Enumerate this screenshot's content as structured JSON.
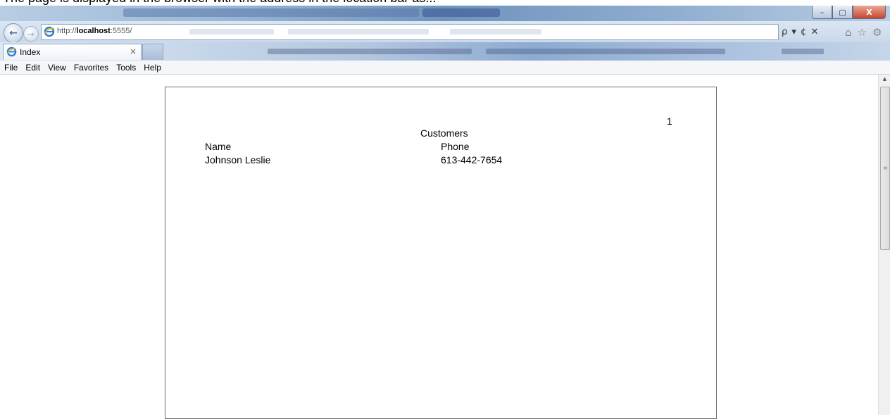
{
  "caption": {
    "text": "The page is displayed in the browser with the address in the location bar as..."
  },
  "window": {
    "controls": {
      "minimize": "–",
      "maximize": "▢",
      "close": "X"
    }
  },
  "nav": {
    "back_icon": "back-arrow-icon",
    "forward_icon": "forward-arrow-icon",
    "url_prefix": "http://",
    "url_host": "localhost",
    "url_rest": ":5555/",
    "address_controls": "ρ ▾ ¢ ✕",
    "right_icons": [
      "home-icon",
      "star-icon",
      "gear-icon"
    ],
    "home_glyph": "⌂",
    "star_glyph": "☆",
    "gear_glyph": "⚙"
  },
  "tabs": [
    {
      "label": "Index",
      "close": "×"
    }
  ],
  "menu": [
    "File",
    "Edit",
    "View",
    "Favorites",
    "Tools",
    "Help"
  ],
  "report": {
    "page_number": "1",
    "title": "Customers",
    "columns": [
      "Name",
      "Phone"
    ],
    "rows": [
      {
        "name": "Johnson Leslie",
        "phone": "613-442-7654"
      }
    ]
  },
  "colors": {
    "window_chrome": "#9ab7d6",
    "close_button": "#c8452d",
    "page_border": "#6e6e6e"
  }
}
